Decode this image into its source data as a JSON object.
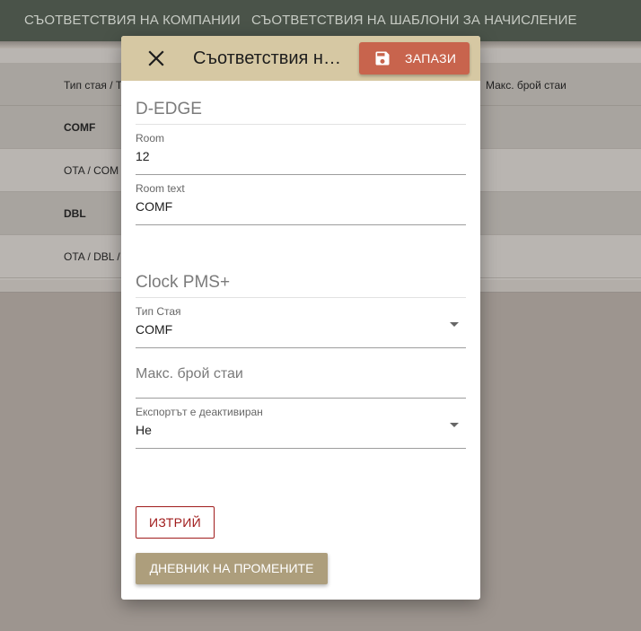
{
  "nav": {
    "tabs": [
      "СЪОТВЕТСТВИЯ НА КОМПАНИИ",
      "СЪОТВЕТСТВИЯ НА ШАБЛОНИ ЗА НАЧИСЛЕНИЕ"
    ]
  },
  "background_table": {
    "headers": [
      "Тип стая / Т",
      "Макс. брой стаи"
    ],
    "rows": [
      "COMF",
      "OTA / COM",
      "DBL",
      "OTA / DBL /"
    ]
  },
  "dialog": {
    "title": "Съответствия на съответствията",
    "save_label": "ЗАПАЗИ",
    "close_icon": "close-icon",
    "save_icon": "floppy-disk-icon",
    "section1_title": "D-EDGE",
    "room": {
      "label": "Room",
      "value": "12"
    },
    "room_text": {
      "label": "Room text",
      "value": "COMF"
    },
    "section2_title": "Clock PMS+",
    "room_type": {
      "label": "Тип Стая",
      "value": "COMF"
    },
    "max_rooms": {
      "placeholder": "Макс. брой стаи"
    },
    "export_disabled": {
      "label": "Експортът е деактивиран",
      "value": "Не"
    },
    "delete_label": "ИЗТРИЙ",
    "change_log_label": "ДНЕВНИК НА ПРОМЕНИТЕ"
  },
  "colors": {
    "topbar": "#4a5349",
    "dialog_header": "#d6c8a3",
    "save_button": "#c8644d",
    "delete_button": "#a01c1c",
    "log_button": "#ad9e7c"
  }
}
